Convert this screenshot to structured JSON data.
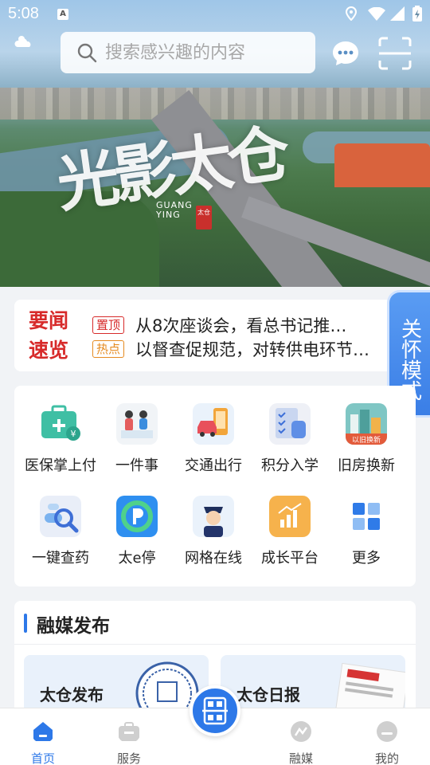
{
  "status_bar": {
    "time": "5:08",
    "a_badge": "A"
  },
  "header": {
    "search_placeholder": "搜索感兴趣的内容"
  },
  "banner": {
    "calligraphy": "光影太仓",
    "caption_en_1": "GUANG",
    "caption_en_2": "YING",
    "seal_text": "太仓"
  },
  "news": {
    "brand_line1": "要闻",
    "brand_line2": "速览",
    "items": [
      {
        "tag": "置顶",
        "title": "从8次座谈会，看总书记推…"
      },
      {
        "tag": "热点",
        "title": "以督查促规范，对转供电环节…"
      }
    ]
  },
  "care_mode": "关怀模式",
  "services": [
    {
      "label": "医保掌上付",
      "icon": "medical-wallet-icon"
    },
    {
      "label": "一件事",
      "icon": "service-desk-icon"
    },
    {
      "label": "交通出行",
      "icon": "car-phone-icon"
    },
    {
      "label": "积分入学",
      "icon": "checklist-bag-icon"
    },
    {
      "label": "旧房换新",
      "icon": "city-building-icon",
      "badge": "以旧换新"
    },
    {
      "label": "一键查药",
      "icon": "medicine-search-icon"
    },
    {
      "label": "太e停",
      "icon": "parking-p-icon"
    },
    {
      "label": "网格在线",
      "icon": "police-avatar-icon"
    },
    {
      "label": "成长平台",
      "icon": "growth-chart-icon"
    },
    {
      "label": "更多",
      "icon": "grid-more-icon"
    }
  ],
  "media": {
    "title": "融媒发布",
    "cards": [
      {
        "label": "太仓发布"
      },
      {
        "label": "太仓日报"
      }
    ]
  },
  "tabs": [
    {
      "label": "首页",
      "active": true
    },
    {
      "label": "服务",
      "active": false
    },
    {
      "label": "融媒",
      "active": false
    },
    {
      "label": "我的",
      "active": false
    }
  ],
  "colors": {
    "accent": "#2d78e8",
    "news_red": "#d72a2a",
    "hot_orange": "#e58a1f"
  }
}
